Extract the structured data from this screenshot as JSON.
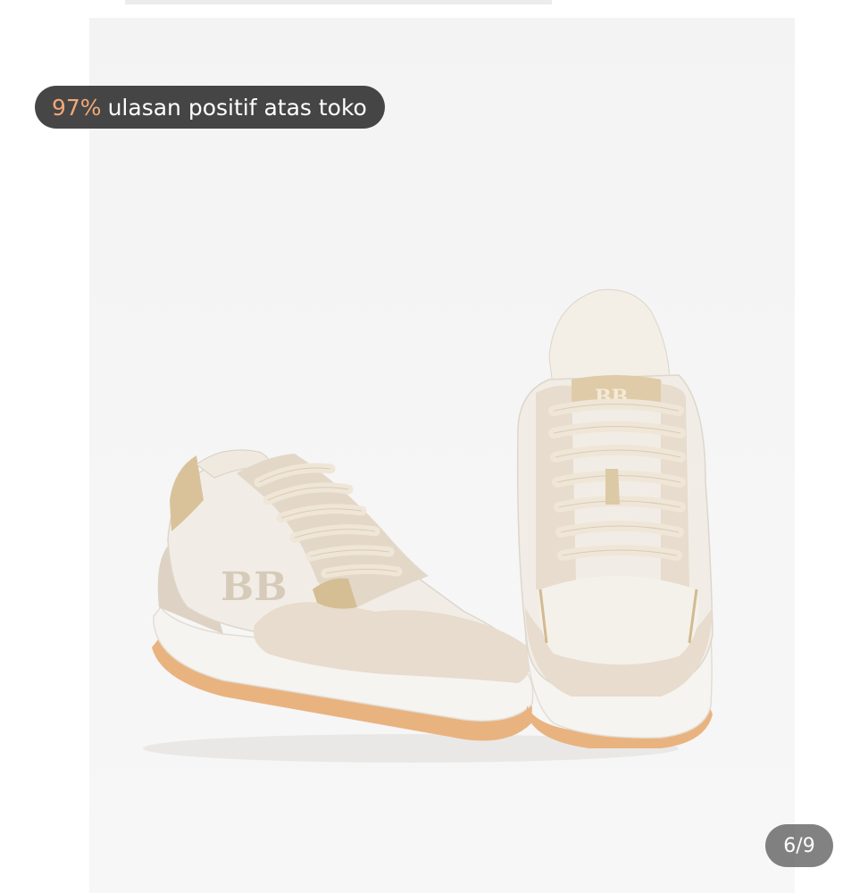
{
  "review_badge": {
    "percent": "97%",
    "text": "ulasan positif atas toko"
  },
  "gallery": {
    "position": "6/9",
    "current_index": 6,
    "total": 9
  },
  "product_image": {
    "subject": "pair of beige and white sneakers",
    "logo_monogram": "BB"
  },
  "colors": {
    "badge_bg": "#282828",
    "badge_percent": "#f1a877",
    "shoe_white": "#f4f1ea",
    "shoe_beige": "#e7dccd",
    "shoe_gold": "#d9c29a",
    "outsole": "#e9b37f"
  }
}
